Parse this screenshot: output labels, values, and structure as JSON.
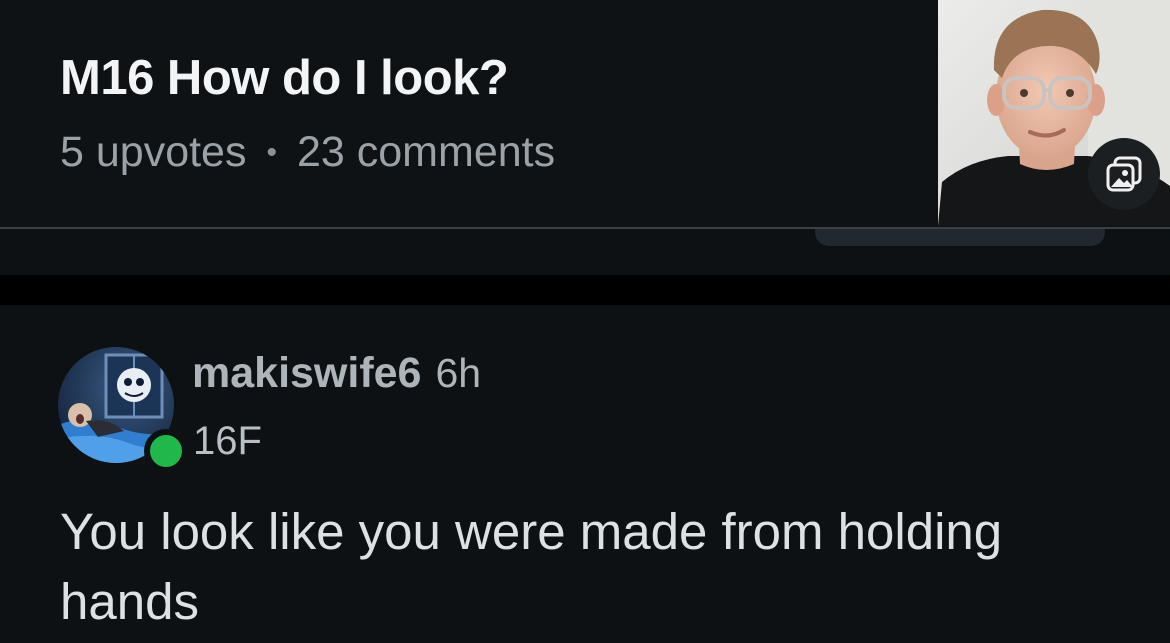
{
  "post": {
    "title": "M16 How do I look?",
    "upvotes": "5 upvotes",
    "separator": "•",
    "comments": "23 comments"
  },
  "thumbnail": {
    "icon": "gallery-icon"
  },
  "comment": {
    "username": "makiswife6",
    "time": "6h",
    "flair": "16F",
    "body": "You look like you were made from holding hands",
    "online_color": "#1fb84a"
  }
}
